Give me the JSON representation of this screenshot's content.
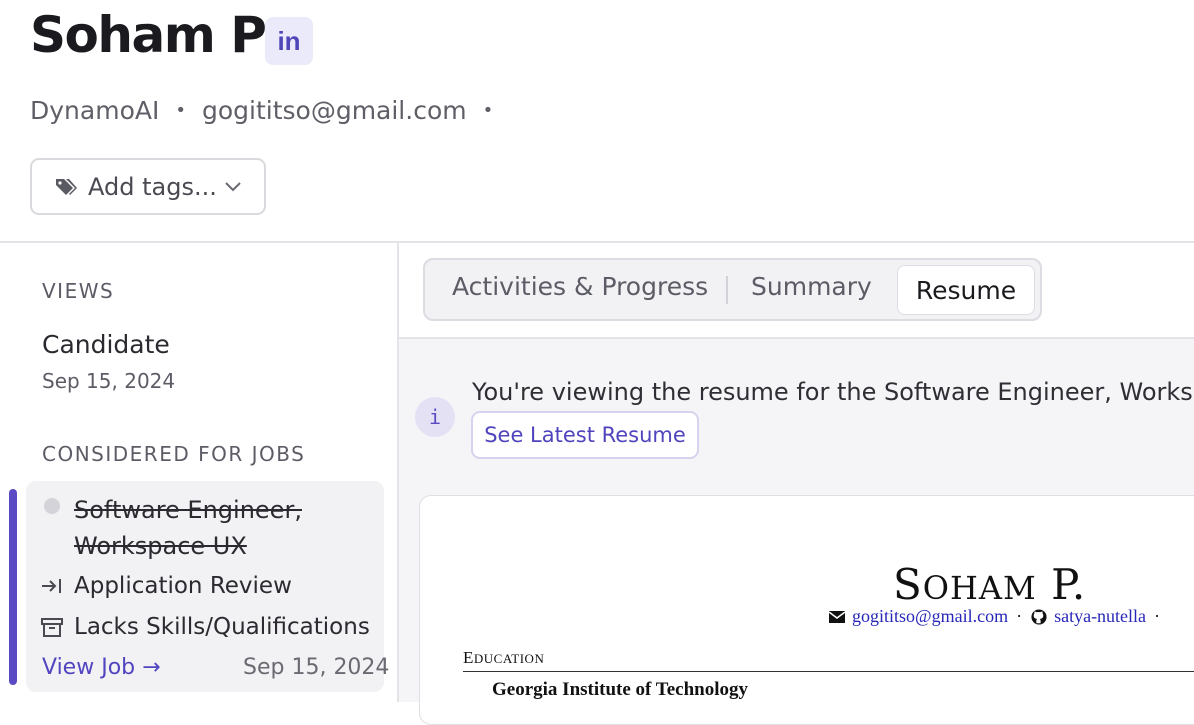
{
  "candidate": {
    "name": "Soham P",
    "linkedin_label": "in",
    "company": "DynamoAI",
    "email": "gogititso@gmail.com",
    "separator": "•"
  },
  "tags": {
    "placeholder": "Add tags..."
  },
  "sidebar": {
    "views_label": "VIEWS",
    "view": {
      "title": "Candidate",
      "date": "Sep 15, 2024"
    },
    "jobs_label": "CONSIDERED FOR JOBS",
    "job": {
      "title": "Software Engineer, Workspace UX",
      "stage": "Application Review",
      "reason": "Lacks Skills/Qualifications",
      "view_job_label": "View Job →",
      "date": "Sep 15, 2024"
    }
  },
  "tabs": {
    "items": [
      "Activities & Progress",
      "Summary",
      "Resume"
    ],
    "active": "Resume"
  },
  "notice": {
    "text": "You're viewing the resume for the Software Engineer, Workspace",
    "button_label": "See Latest Resume",
    "icon_char": "i"
  },
  "resume": {
    "name_first_initial": "S",
    "name_first_rest": "OHAM",
    "name_last_initial": "P",
    "name_last_rest": ".",
    "email": "gogititso@gmail.com",
    "github": "satya-nutella",
    "contact_sep": "·",
    "section_initial": "E",
    "section_rest": "DUCATION",
    "school": "Georgia Institute of Technology"
  },
  "colors": {
    "accent": "#5a4bc4",
    "link": "#5145c0"
  }
}
